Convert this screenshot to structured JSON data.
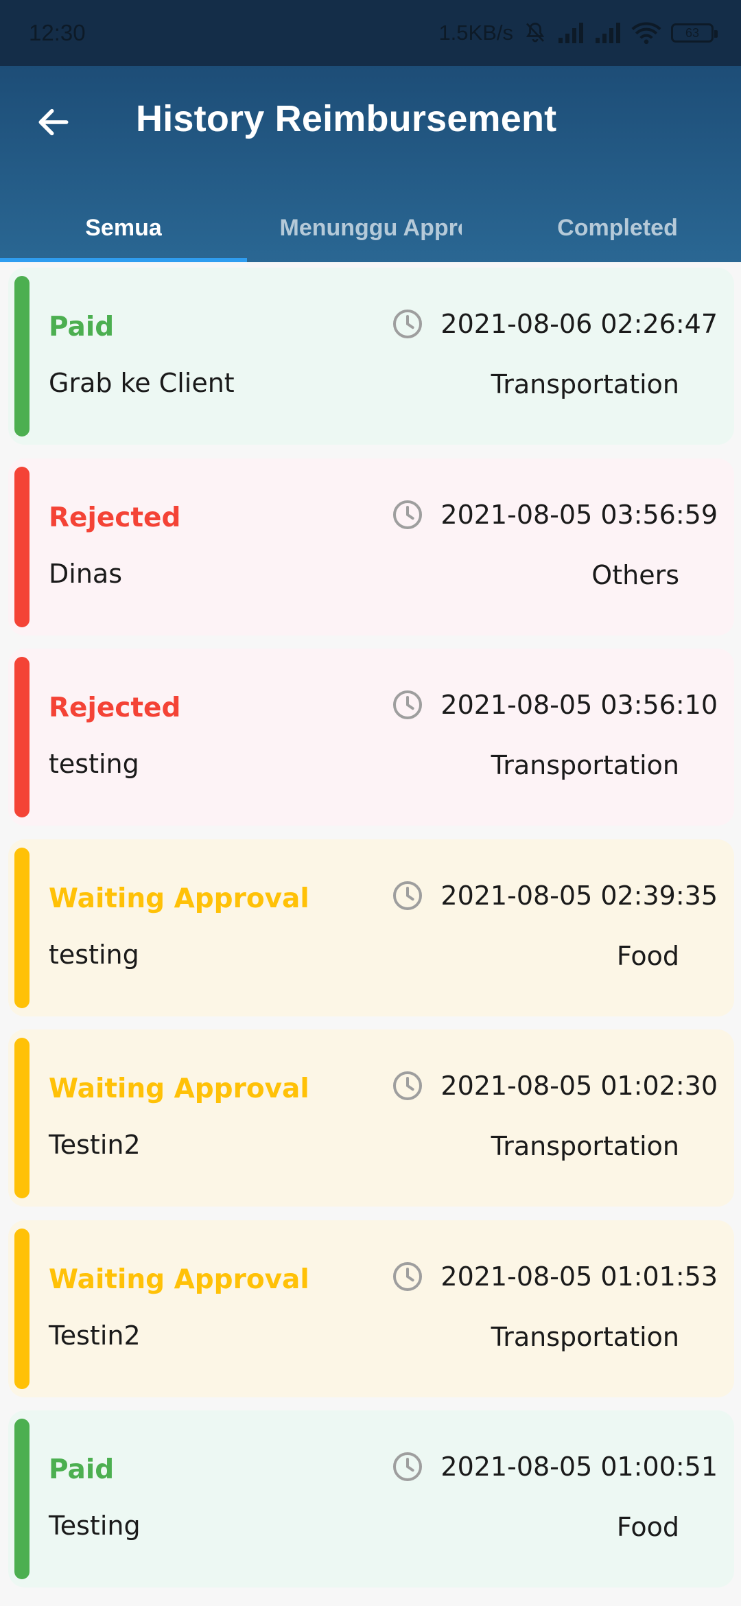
{
  "status_bar": {
    "time": "12:30",
    "net_speed": "1.5KB/s",
    "battery": "63",
    "icons": [
      "mute-bell-icon",
      "signal-icon",
      "signal-icon",
      "wifi-icon",
      "battery-icon"
    ]
  },
  "app_bar": {
    "title": "History Reimbursement",
    "back_icon": "arrow-left-icon"
  },
  "tabs": [
    {
      "label": "Semua",
      "active": true
    },
    {
      "label": "Menunggu Approval",
      "active": false
    },
    {
      "label": "Completed",
      "active": false
    }
  ],
  "colors": {
    "paid": "#4caf50",
    "paid_bg": "#edf8f3",
    "rejected": "#f44336",
    "rejected_bg": "#fdf3f6",
    "waiting": "#ffc107",
    "waiting_bg": "#fcf6e6",
    "tab_indicator": "#2f9df0"
  },
  "items": [
    {
      "status": "Paid",
      "kind": "paid",
      "description": "Grab ke Client",
      "datetime": "2021-08-06 02:26:47",
      "category": "Transportation"
    },
    {
      "status": "Rejected",
      "kind": "rejected",
      "description": "Dinas",
      "datetime": "2021-08-05 03:56:59",
      "category": "Others"
    },
    {
      "status": "Rejected",
      "kind": "rejected",
      "description": "testing",
      "datetime": "2021-08-05 03:56:10",
      "category": "Transportation"
    },
    {
      "status": "Waiting Approval",
      "kind": "waiting",
      "description": "testing",
      "datetime": "2021-08-05 02:39:35",
      "category": "Food"
    },
    {
      "status": "Waiting Approval",
      "kind": "waiting",
      "description": "Testin2",
      "datetime": "2021-08-05 01:02:30",
      "category": "Transportation"
    },
    {
      "status": "Waiting Approval",
      "kind": "waiting",
      "description": "Testin2",
      "datetime": "2021-08-05 01:01:53",
      "category": "Transportation"
    },
    {
      "status": "Paid",
      "kind": "paid",
      "description": "Testing",
      "datetime": "2021-08-05 01:00:51",
      "category": "Food"
    }
  ]
}
